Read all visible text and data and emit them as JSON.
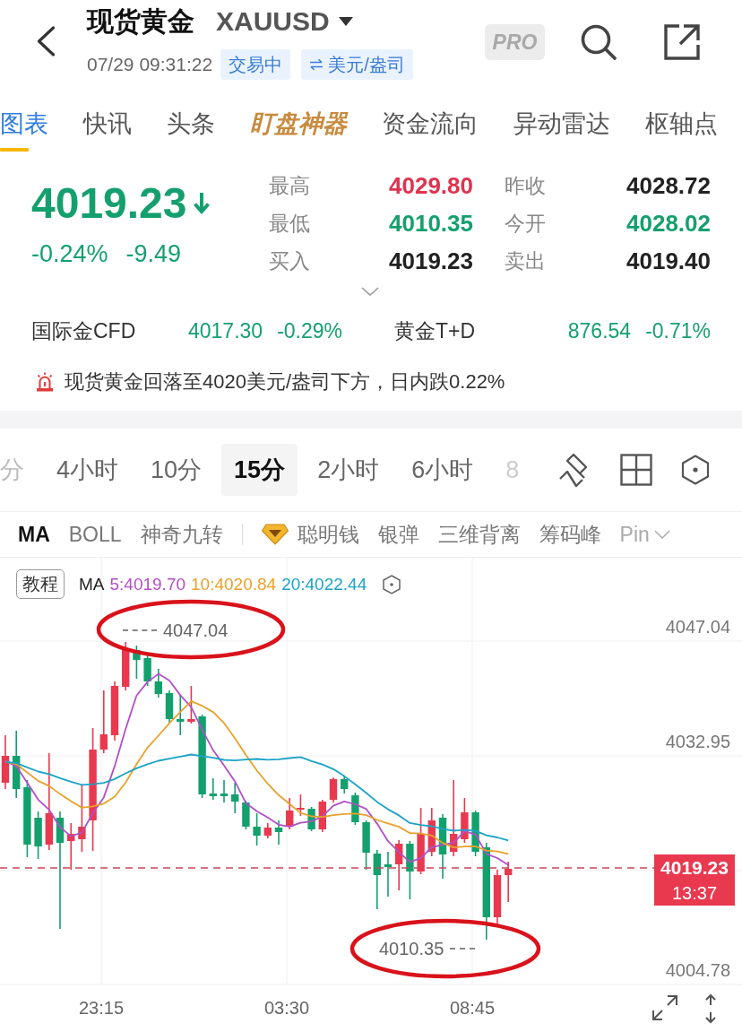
{
  "header": {
    "title": "现货黄金",
    "symbol": "XAUUSD",
    "timestamp": "07/29 09:31:22",
    "status": "交易中",
    "unit": "美元/盎司",
    "pro": "PRO"
  },
  "tabs": [
    {
      "label": "图表",
      "selected": true,
      "kind": "plain"
    },
    {
      "label": "快讯",
      "selected": false,
      "kind": "plain"
    },
    {
      "label": "头条",
      "selected": false,
      "kind": "plain"
    },
    {
      "label": "盯盘神器",
      "selected": false,
      "kind": "featured"
    },
    {
      "label": "资金流向",
      "selected": false,
      "kind": "plain"
    },
    {
      "label": "异动雷达",
      "selected": false,
      "kind": "plain"
    },
    {
      "label": "枢轴点",
      "selected": false,
      "kind": "plain"
    }
  ],
  "quote": {
    "price": "4019.23",
    "falling": true,
    "change_percent": "-0.24%",
    "change": "-9.49",
    "stats": [
      {
        "label": "最高",
        "value": "4029.80",
        "color": "#e0334f"
      },
      {
        "label": "昨收",
        "value": "4028.72",
        "color": "#222222"
      },
      {
        "label": "最低",
        "value": "4010.35",
        "color": "#14a06e"
      },
      {
        "label": "今开",
        "value": "4028.02",
        "color": "#14a06e"
      },
      {
        "label": "买入",
        "value": "4019.23",
        "color": "#222222"
      },
      {
        "label": "卖出",
        "value": "4019.40",
        "color": "#222222"
      }
    ]
  },
  "related": [
    {
      "name": "国际金CFD",
      "price": "4017.30",
      "change": "-0.29%",
      "falling": true
    },
    {
      "name": "黄金T+D",
      "price": "876.54",
      "change": "-0.71%",
      "falling": true
    }
  ],
  "alert": "现货黄金回落至4020美元/盎司下方，日内跌0.22%",
  "timeframes": [
    {
      "label": "分",
      "selected": false
    },
    {
      "label": "4小时",
      "selected": false
    },
    {
      "label": "10分",
      "selected": false
    },
    {
      "label": "15分",
      "selected": true
    },
    {
      "label": "2小时",
      "selected": false
    },
    {
      "label": "6小时",
      "selected": false
    },
    {
      "label": "8",
      "selected": false
    }
  ],
  "indicators": [
    {
      "label": "MA",
      "selected": true,
      "kind": "plain"
    },
    {
      "label": "BOLL",
      "selected": false,
      "kind": "plain"
    },
    {
      "label": "神奇九转",
      "selected": false,
      "kind": "plain"
    },
    {
      "label": "聪明钱",
      "selected": false,
      "kind": "premium"
    },
    {
      "label": "银弹",
      "selected": false,
      "kind": "plain"
    },
    {
      "label": "三维背离",
      "selected": false,
      "kind": "plain"
    },
    {
      "label": "筹码峰",
      "selected": false,
      "kind": "plain"
    },
    {
      "label": "Pin",
      "selected": false,
      "kind": "plain"
    }
  ],
  "chart": {
    "tutorial_button": "教程",
    "ma_label": "MA",
    "ma_lines": [
      {
        "text": "5:4019.70",
        "color": "#b14fc7"
      },
      {
        "text": "10:4020.84",
        "color": "#e9a12a"
      },
      {
        "text": "20:4022.44",
        "color": "#1ba3c6"
      }
    ],
    "y_axis": [
      "4047.04",
      "4032.95",
      "4004.78"
    ],
    "x_axis": [
      "23:15",
      "03:30",
      "08:45"
    ],
    "high_marker": {
      "text": "4047.04",
      "circled": true
    },
    "low_marker": {
      "text": "4010.35",
      "circled": true
    },
    "last_price_tag": {
      "price": "4019.23",
      "countdown": "13:37"
    }
  }
}
